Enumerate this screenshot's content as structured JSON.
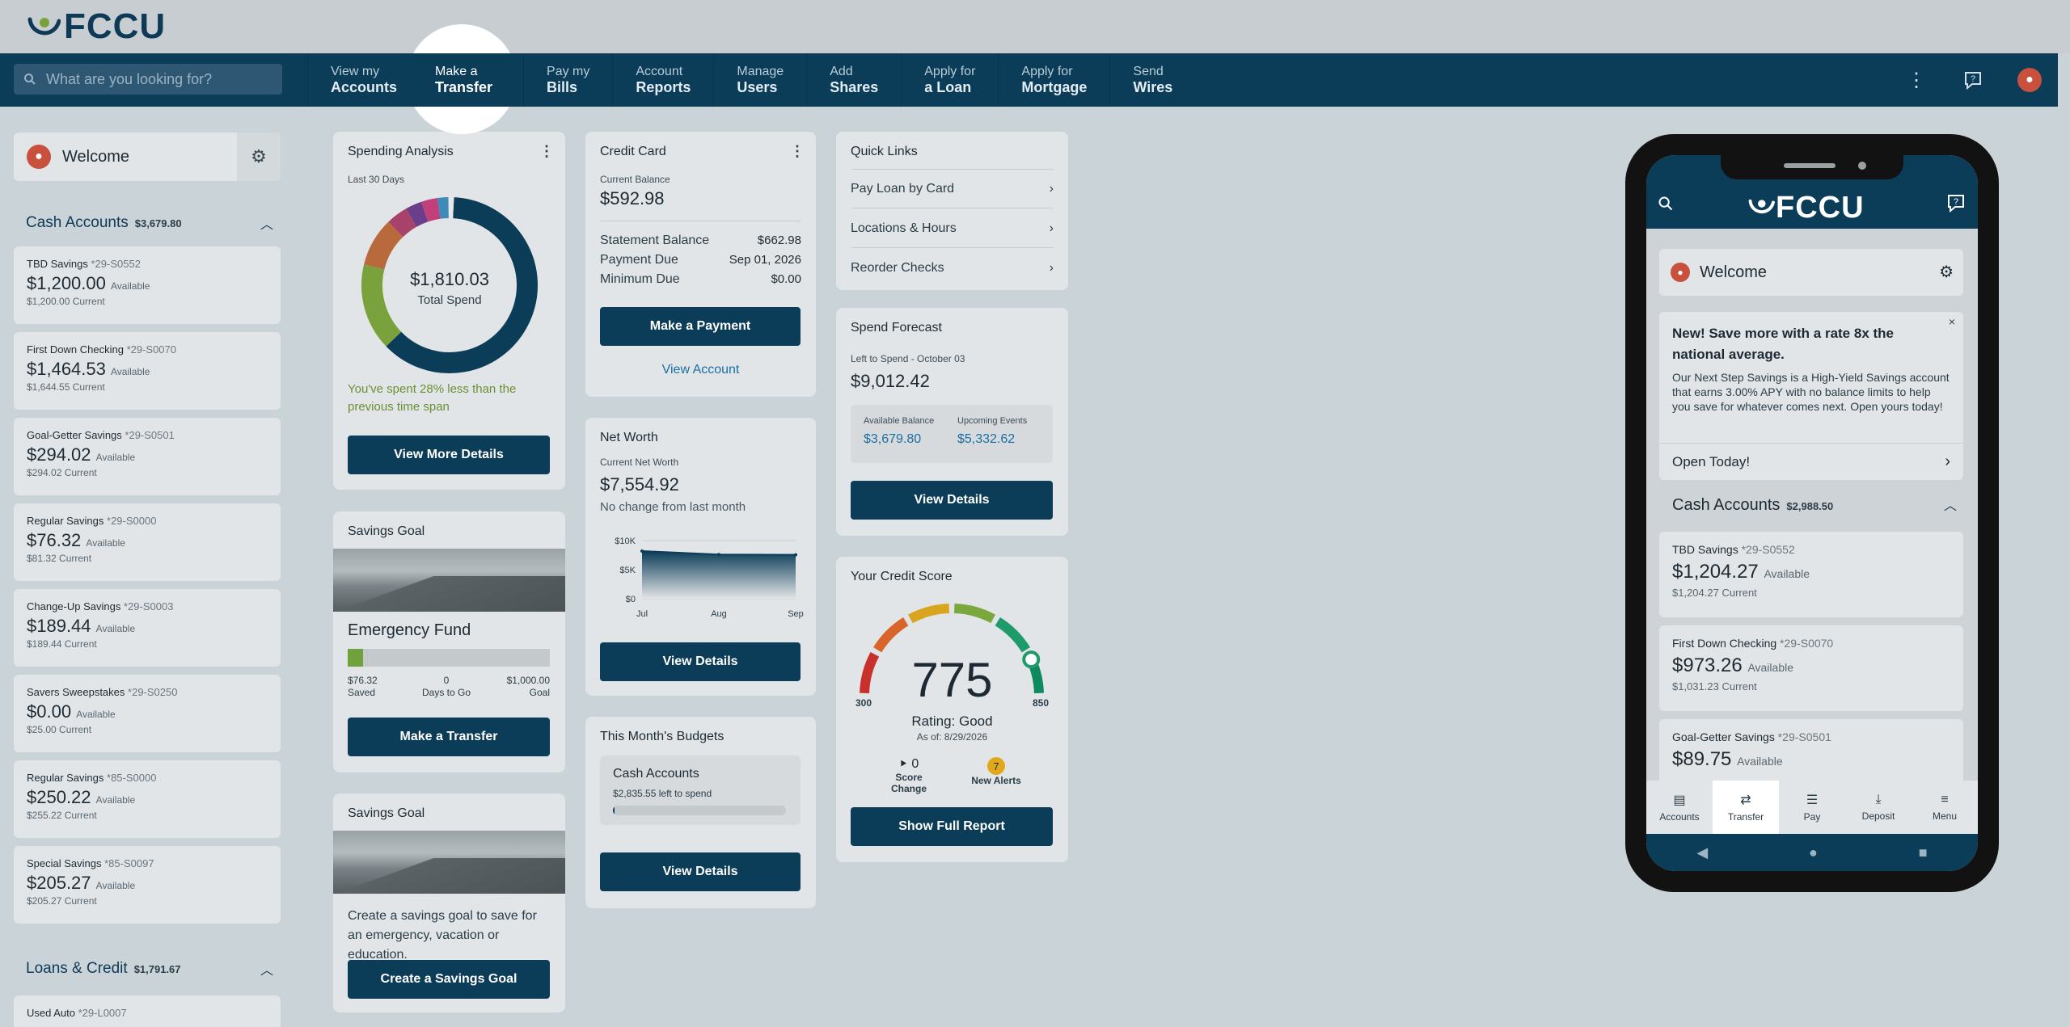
{
  "brand": {
    "name": "FCCU",
    "color": "#0b3c58"
  },
  "search": {
    "placeholder": "What are you looking for?"
  },
  "nav": [
    {
      "l1": "View my",
      "l2": "Accounts"
    },
    {
      "l1": "Make a",
      "l2": "Transfer"
    },
    {
      "l1": "Pay my",
      "l2": "Bills"
    },
    {
      "l1": "Account",
      "l2": "Reports"
    },
    {
      "l1": "Manage",
      "l2": "Users"
    },
    {
      "l1": "Add",
      "l2": "Shares"
    },
    {
      "l1": "Apply for",
      "l2": "a Loan"
    },
    {
      "l1": "Apply for",
      "l2": "Mortgage"
    },
    {
      "l1": "Send",
      "l2": "Wires"
    }
  ],
  "sidebar": {
    "welcome": "Welcome",
    "cash": {
      "title": "Cash Accounts",
      "amount": "$3,679.80"
    },
    "accounts": [
      {
        "name": "TBD Savings",
        "num": "*29-S0552",
        "bal": "$1,200.00",
        "avail": "Available",
        "current": "$1,200.00 Current"
      },
      {
        "name": "First Down Checking",
        "num": "*29-S0070",
        "bal": "$1,464.53",
        "avail": "Available",
        "current": "$1,644.55 Current"
      },
      {
        "name": "Goal-Getter Savings",
        "num": "*29-S0501",
        "bal": "$294.02",
        "avail": "Available",
        "current": "$294.02 Current"
      },
      {
        "name": "Regular Savings",
        "num": "*29-S0000",
        "bal": "$76.32",
        "avail": "Available",
        "current": "$81.32 Current"
      },
      {
        "name": "Change-Up Savings",
        "num": "*29-S0003",
        "bal": "$189.44",
        "avail": "Available",
        "current": "$189.44 Current"
      },
      {
        "name": "Savers Sweepstakes",
        "num": "*29-S0250",
        "bal": "$0.00",
        "avail": "Available",
        "current": "$25.00 Current"
      },
      {
        "name": "Regular Savings",
        "num": "*85-S0000",
        "bal": "$250.22",
        "avail": "Available",
        "current": "$255.22 Current"
      },
      {
        "name": "Special Savings",
        "num": "*85-S0097",
        "bal": "$205.27",
        "avail": "Available",
        "current": "$205.27 Current"
      }
    ],
    "loans": {
      "title": "Loans & Credit",
      "amount": "$1,791.67"
    },
    "loan_first": {
      "name": "Used Auto",
      "num": "*29-L0007"
    }
  },
  "spending": {
    "title": "Spending Analysis",
    "period": "Last 30 Days",
    "total": "$1,810.03",
    "total_label": "Total Spend",
    "note": "You've spent 28% less than the previous time span",
    "button": "View More Details",
    "segments": [
      {
        "value": 62,
        "color": "#0b3c58"
      },
      {
        "value": 16,
        "color": "#7aa23c"
      },
      {
        "value": 9,
        "color": "#b86a3c"
      },
      {
        "value": 4,
        "color": "#a8426a"
      },
      {
        "value": 3,
        "color": "#6b3e8a"
      },
      {
        "value": 3,
        "color": "#c2407a"
      },
      {
        "value": 2,
        "color": "#3e8ab8"
      },
      {
        "value": 1,
        "color": "#e8e8e8"
      }
    ]
  },
  "savings_goal_1": {
    "title": "Savings Goal",
    "name": "Emergency Fund",
    "progress": 0.076,
    "saved": "$76.32",
    "saved_label": "Saved",
    "days": "0",
    "days_label": "Days to Go",
    "goal": "$1,000.00",
    "goal_label": "Goal",
    "button": "Make a Transfer"
  },
  "savings_goal_2": {
    "title": "Savings Goal",
    "text": "Create a savings goal to save for an emergency, vacation or education.",
    "button": "Create a Savings Goal"
  },
  "credit_card": {
    "title": "Credit Card",
    "current_label": "Current Balance",
    "current": "$592.98",
    "rows": [
      {
        "k": "Statement Balance",
        "v": "$662.98"
      },
      {
        "k": "Payment Due",
        "v": "Sep 01, 2026"
      },
      {
        "k": "Minimum Due",
        "v": "$0.00"
      }
    ],
    "button": "Make a Payment",
    "link": "View Account"
  },
  "net_worth": {
    "title": "Net Worth",
    "label": "Current Net Worth",
    "value": "$7,554.92",
    "change": "No change from last month",
    "button": "View Details",
    "chart_data": {
      "type": "area",
      "x": [
        "Jul",
        "Aug",
        "Sep"
      ],
      "values": [
        8200,
        7600,
        7554.92
      ],
      "yticks": [
        "$10K",
        "$5K",
        "$0"
      ],
      "ylim": [
        0,
        10000
      ]
    }
  },
  "budgets": {
    "title": "This Month's Budgets",
    "item": "Cash Accounts",
    "amount": "$2,835.55",
    "left": "left to spend",
    "progress": 0.01,
    "button": "View Details"
  },
  "quick_links": {
    "title": "Quick Links",
    "items": [
      "Pay Loan by Card",
      "Locations & Hours",
      "Reorder Checks"
    ]
  },
  "forecast": {
    "title": "Spend Forecast",
    "left_label": "Left to Spend - October 03",
    "left_value": "$9,012.42",
    "avail_label": "Available Balance",
    "avail_value": "$3,679.80",
    "events_label": "Upcoming Events",
    "events_value": "$5,332.62",
    "button": "View Details"
  },
  "credit_score": {
    "title": "Your Credit Score",
    "score": "775",
    "min": "300",
    "max": "850",
    "score_value": 775,
    "rating": "Rating: Good",
    "asof": "As of: 8/29/2026",
    "change": "0",
    "change_label": "Score Change",
    "alerts": "7",
    "alerts_label": "New Alerts",
    "button": "Show Full Report"
  },
  "phone": {
    "welcome": "Welcome",
    "promo_title": "New! Save more with a rate 8x the national average.",
    "promo_text": "Our Next Step Savings is a High-Yield Savings account that earns 3.00% APY with no balance limits to help you save for whatever comes next. Open yours today!",
    "promo_link": "Open Today!",
    "cash_title": "Cash Accounts",
    "cash_amount": "$2,988.50",
    "accounts": [
      {
        "name": "TBD Savings",
        "num": "*29-S0552",
        "bal": "$1,204.27",
        "avail": "Available",
        "current": "$1,204.27 Current"
      },
      {
        "name": "First Down Checking",
        "num": "*29-S0070",
        "bal": "$973.26",
        "avail": "Available",
        "current": "$1,031.23 Current"
      },
      {
        "name": "Goal-Getter Savings",
        "num": "*29-S0501",
        "bal": "$89.75",
        "avail": "Available",
        "current": ""
      }
    ],
    "tabs": [
      "Accounts",
      "Transfer",
      "Pay",
      "Deposit",
      "Menu"
    ]
  }
}
